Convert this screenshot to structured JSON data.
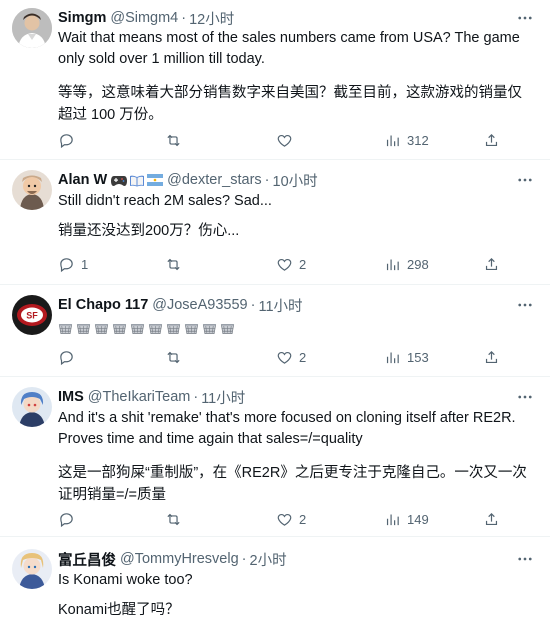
{
  "posts": [
    {
      "name": "Simgm",
      "handle": "@Simgm4",
      "time": "12小时",
      "badges": [],
      "text": "Wait that means most of the sales numbers came from USA? The game only sold over 1 million till today.",
      "translation": "等等，这意味着大部分销售数字来自美国？截至目前，这款游戏的销量仅超过 100 万份。",
      "replies": "",
      "retweets": "",
      "likes": "",
      "views": "312"
    },
    {
      "name": "Alan W",
      "handle": "@dexter_stars",
      "time": "10小时",
      "badges": [
        "controller-emoji",
        "book-emoji",
        "argentina-flag-emoji"
      ],
      "text": "Still didn't reach 2M sales? Sad...",
      "translation": "销量还没达到200万？伤心...",
      "replies": "1",
      "retweets": "",
      "likes": "2",
      "views": "298"
    },
    {
      "name": "El Chapo 117",
      "handle": "@JoseA93559",
      "time": "11小时",
      "badges": [],
      "text": "",
      "emoji_count": 10,
      "translation": "",
      "replies": "",
      "retweets": "",
      "likes": "2",
      "views": "153"
    },
    {
      "name": "IMS",
      "handle": "@TheIkariTeam",
      "time": "11小时",
      "badges": [],
      "text": "And it's a shit 'remake' that's more focused on cloning itself after RE2R. Proves time and time again that sales=/=quality",
      "translation": "这是一部狗屎“重制版”，在《RE2R》之后更专注于克隆自己。一次又一次证明销量=/=质量",
      "replies": "",
      "retweets": "",
      "likes": "2",
      "views": "149"
    },
    {
      "name": "富丘昌俊",
      "handle": "@TommyHresvelg",
      "time": "2小时",
      "badges": [],
      "text": "Is Konami woke too?",
      "translation": "Konami也醒了吗？",
      "replies": "",
      "retweets": "",
      "likes": "",
      "views": ""
    }
  ],
  "separator": "·",
  "colors": {
    "text": "#0f1419",
    "muted": "#536471",
    "border": "#eff3f4"
  },
  "icons": [
    "reply-icon",
    "retweet-icon",
    "like-icon",
    "views-icon",
    "share-icon",
    "more-icon"
  ]
}
